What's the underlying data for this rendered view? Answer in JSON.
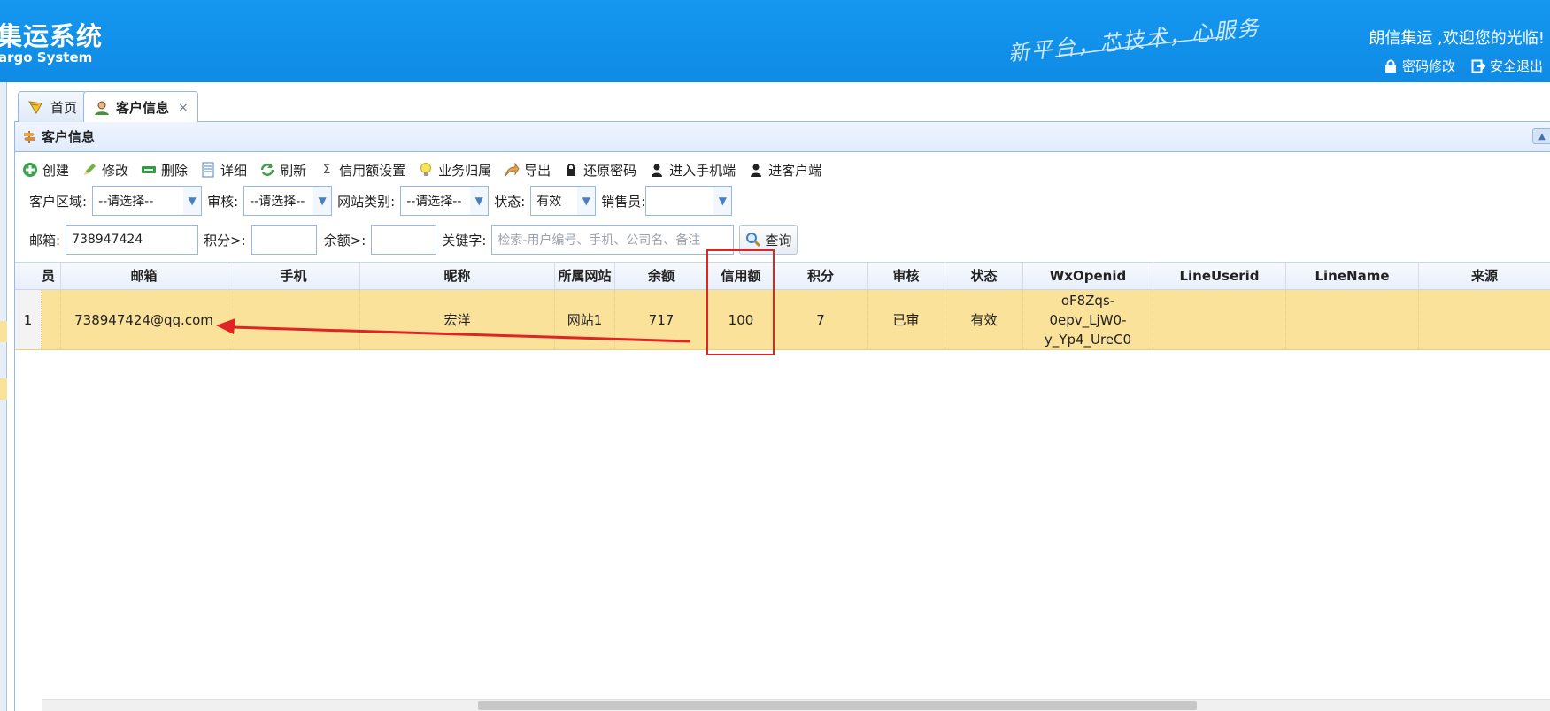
{
  "header": {
    "logo_cn": "集运系统",
    "logo_en": "argo System",
    "slogan": "新平台，芯技术，心服务",
    "welcome": "朗信集运 ,欢迎您的光临!",
    "links": {
      "password": "密码修改",
      "logout": "安全退出"
    }
  },
  "tabs": [
    {
      "label": "首页"
    },
    {
      "label": "客户信息",
      "close": "×"
    }
  ],
  "panel": {
    "title": "客户信息"
  },
  "toolbar": {
    "create": "创建",
    "edit": "修改",
    "delete": "删除",
    "detail": "详细",
    "refresh": "刷新",
    "credit": "信用额设置",
    "business": "业务归属",
    "export": "导出",
    "reset_pwd": "还原密码",
    "mobile": "进入手机端",
    "client": "进客户端"
  },
  "filters": {
    "region_label": "客户区域:",
    "region_value": "--请选择--",
    "audit_label": "审核:",
    "audit_value": "--请选择--",
    "site_label": "网站类别:",
    "site_value": "--请选择--",
    "status_label": "状态:",
    "status_value": "有效",
    "sales_label": "销售员:",
    "sales_value": "",
    "email_label": "邮箱:",
    "email_value": "738947424",
    "points_label": "积分>:",
    "points_value": "",
    "balance_label": "余额>:",
    "balance_value": "",
    "keyword_label": "关键字:",
    "keyword_placeholder": "检索-用户编号、手机、公司名、备注",
    "query_button": "查询"
  },
  "grid": {
    "columns": [
      "员",
      "邮箱",
      "手机",
      "昵称",
      "所属网站",
      "余额",
      "信用额",
      "积分",
      "审核",
      "状态",
      "WxOpenid",
      "LineUserid",
      "LineName",
      "来源"
    ],
    "rows": [
      {
        "num": "1",
        "email": "738947424@qq.com",
        "phone": "",
        "nickname": "宏洋",
        "site": "网站1",
        "balance": "717",
        "credit": "100",
        "points": "7",
        "audit": "已审",
        "status": "有效",
        "wx_line1": "oF8Zqs-",
        "wx_line2": "0epv_LjW0-",
        "wx_line3": "y_Yp4_UreC0",
        "line_userid": "",
        "line_name": "",
        "source": ""
      }
    ]
  },
  "colors": {
    "header_bg": "#1597ef",
    "selected_row": "#fbe29a",
    "annotation": "#e02424",
    "border": "#95b8e7"
  }
}
